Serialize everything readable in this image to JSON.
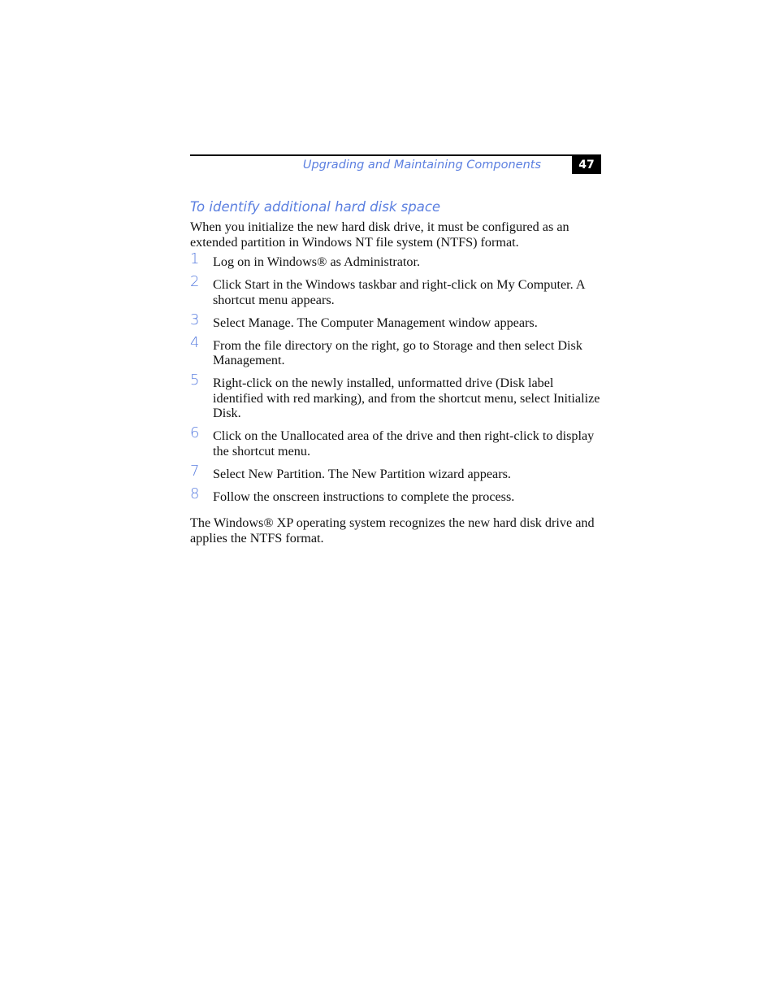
{
  "header": {
    "title": "Upgrading and Maintaining Components",
    "page_number": "47"
  },
  "section": {
    "title": "To identify additional hard disk space",
    "intro": "When you initialize the new hard disk drive, it must be configured as an extended partition in Windows NT file system (NTFS) format."
  },
  "steps": [
    {
      "num": "1",
      "text": "Log on in Windows® as Administrator."
    },
    {
      "num": "2",
      "text": "Click Start in the Windows taskbar and right-click on My Computer. A shortcut menu appears."
    },
    {
      "num": "3",
      "text": "Select Manage. The Computer Management window appears."
    },
    {
      "num": "4",
      "text": "From the file directory on the right, go to Storage and then select Disk Management."
    },
    {
      "num": "5",
      "text": "Right-click on the newly installed, unformatted drive (Disk label identified with red marking), and from the shortcut menu, select Initialize Disk."
    },
    {
      "num": "6",
      "text": "Click on the Unallocated area of the drive and then right-click to display the shortcut menu."
    },
    {
      "num": "7",
      "text": "Select New Partition. The New Partition wizard appears."
    },
    {
      "num": "8",
      "text": "Follow the onscreen instructions to complete the process."
    }
  ],
  "closing": "The Windows® XP operating system recognizes the new hard disk drive and applies the NTFS format.",
  "colors": {
    "accent": "#5b7fe0",
    "text": "#111111",
    "page_number_bg": "#000000"
  }
}
